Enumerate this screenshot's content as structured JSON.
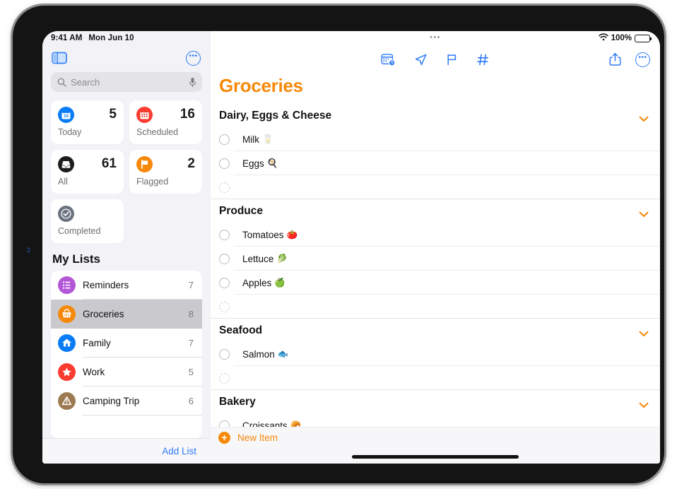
{
  "device": {
    "bezel_marker": "2"
  },
  "status_bar": {
    "time": "9:41 AM",
    "date": "Mon Jun 10",
    "wifi_icon": "wifi-icon",
    "battery_percent": "100%",
    "window_dots": "•••"
  },
  "sidebar": {
    "toggle_icon": "sidebar-toggle-icon",
    "more_icon": "more-options-icon",
    "search": {
      "placeholder": "Search",
      "search_icon": "search-icon",
      "mic_icon": "microphone-icon"
    },
    "smart_lists": [
      {
        "label": "Today",
        "count": "5",
        "icon": "today-calendar-icon",
        "color": "#0a7cf6"
      },
      {
        "label": "Scheduled",
        "count": "16",
        "icon": "scheduled-calendar-icon",
        "color": "#fa3b2f"
      },
      {
        "label": "All",
        "count": "61",
        "icon": "all-inbox-icon",
        "color": "#1c1c1e"
      },
      {
        "label": "Flagged",
        "count": "2",
        "icon": "flag-icon",
        "color": "#f6890a"
      },
      {
        "label": "Completed",
        "count": "",
        "icon": "checkmark-icon",
        "color": "#6b7280"
      }
    ],
    "my_lists_title": "My Lists",
    "lists": [
      {
        "name": "Reminders",
        "count": "7",
        "icon": "bullet-list-icon",
        "color": "#b357d6",
        "selected": false
      },
      {
        "name": "Groceries",
        "count": "8",
        "icon": "basket-icon",
        "color": "#f6890a",
        "selected": true
      },
      {
        "name": "Family",
        "count": "7",
        "icon": "house-icon",
        "color": "#0a7cf6",
        "selected": false
      },
      {
        "name": "Work",
        "count": "5",
        "icon": "star-icon",
        "color": "#fa3b2f",
        "selected": false
      },
      {
        "name": "Camping Trip",
        "count": "6",
        "icon": "triangle-tent-icon",
        "color": "#9c7b53",
        "selected": false
      }
    ],
    "add_list_label": "Add List"
  },
  "content": {
    "toolbar_center_icons": [
      "calendar-clock-icon",
      "location-arrow-icon",
      "flag-icon",
      "tag-hash-icon"
    ],
    "toolbar_right_icons": [
      "share-icon",
      "more-options-icon"
    ],
    "title": "Groceries",
    "title_color": "#f6890a",
    "accent_color": "#f6890a",
    "sections": [
      {
        "title": "Dairy, Eggs & Cheese",
        "chevron_icon": "chevron-down-icon",
        "items": [
          {
            "text": "Milk",
            "emoji": "🥛",
            "placeholder": false
          },
          {
            "text": "Eggs",
            "emoji": "🍳",
            "placeholder": false
          },
          {
            "text": "",
            "emoji": "",
            "placeholder": true
          }
        ]
      },
      {
        "title": "Produce",
        "chevron_icon": "chevron-down-icon",
        "items": [
          {
            "text": "Tomatoes",
            "emoji": "🍅",
            "placeholder": false
          },
          {
            "text": "Lettuce",
            "emoji": "🥬",
            "placeholder": false
          },
          {
            "text": "Apples",
            "emoji": "🍏",
            "placeholder": false
          },
          {
            "text": "",
            "emoji": "",
            "placeholder": true
          }
        ]
      },
      {
        "title": "Seafood",
        "chevron_icon": "chevron-down-icon",
        "items": [
          {
            "text": "Salmon",
            "emoji": "🐟",
            "placeholder": false
          },
          {
            "text": "",
            "emoji": "",
            "placeholder": true
          }
        ]
      },
      {
        "title": "Bakery",
        "chevron_icon": "chevron-down-icon",
        "items": [
          {
            "text": "Croissants",
            "emoji": "🥐",
            "placeholder": false
          }
        ]
      }
    ],
    "new_item": {
      "label": "New Item",
      "icon": "plus-circle-icon"
    }
  }
}
